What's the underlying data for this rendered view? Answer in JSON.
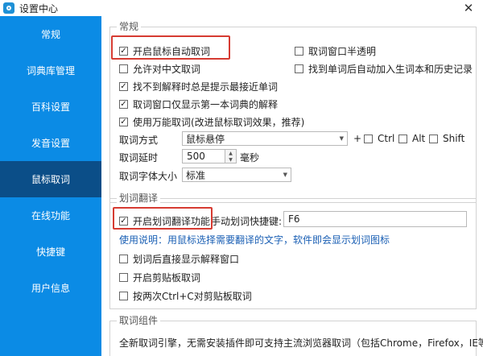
{
  "window": {
    "title": "设置中心",
    "close": "✕"
  },
  "sidebar": {
    "items": [
      {
        "label": "常规"
      },
      {
        "label": "词典库管理"
      },
      {
        "label": "百科设置"
      },
      {
        "label": "发音设置"
      },
      {
        "label": "鼠标取词"
      },
      {
        "label": "在线功能"
      },
      {
        "label": "快捷键"
      },
      {
        "label": "用户信息"
      }
    ],
    "active_index": 4
  },
  "general": {
    "legend": "常规",
    "enable_capture": {
      "label": "开启鼠标自动取词",
      "checked": true
    },
    "translucent": {
      "label": "取词窗口半透明",
      "checked": false
    },
    "allow_chinese": {
      "label": "允许对中文取词",
      "checked": false
    },
    "auto_add": {
      "label": "找到单词后自动加入生词本和历史记录",
      "checked": false
    },
    "hint_nearest": {
      "label": "找不到解释时总是提示最接近单词",
      "checked": true
    },
    "show_first": {
      "label": "取词窗口仅显示第一本词典的解释",
      "checked": true
    },
    "universal": {
      "label": "使用万能取词(改进鼠标取词效果，推荐)",
      "checked": true
    },
    "method": {
      "label": "取词方式",
      "value": "鼠标悬停",
      "plus": "+"
    },
    "ctrl": {
      "label": "Ctrl",
      "checked": false
    },
    "alt": {
      "label": "Alt",
      "checked": false
    },
    "shift": {
      "label": "Shift",
      "checked": false
    },
    "delay": {
      "label": "取词延时",
      "value": "500",
      "unit": "毫秒"
    },
    "font_size": {
      "label": "取词字体大小",
      "value": "标准"
    }
  },
  "translate": {
    "legend": "划词翻译",
    "enable": {
      "label": "开启划词翻译功能",
      "checked": true
    },
    "hotkey_label": "手动划词快捷键:",
    "hotkey_value": "F6",
    "usage": "使用说明：用鼠标选择需要翻译的文字，软件即会显示划词图标",
    "show_direct": {
      "label": "划词后直接显示解释窗口",
      "checked": false
    },
    "clipboard": {
      "label": "开启剪贴板取词",
      "checked": false
    },
    "ctrl_c": {
      "label": "按两次Ctrl+C对剪贴板取词",
      "checked": false
    }
  },
  "component": {
    "legend": "取词组件",
    "text": "全新取词引擎，无需安装插件即可支持主流浏览器取词（包括Chrome，Firefox，IE等）"
  },
  "colors": {
    "sidebar": "#0b8be5",
    "sidebar_active": "#0b4e88",
    "highlight": "#d63b32"
  }
}
